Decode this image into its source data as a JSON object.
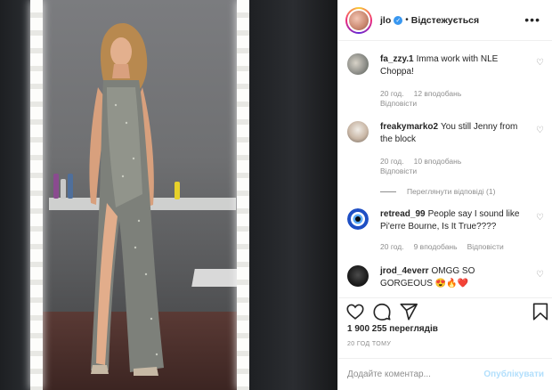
{
  "post": {
    "username": "jlo",
    "dot": "•",
    "follow_state": "Відстежується",
    "more": "•••"
  },
  "comments": [
    {
      "username": "fa_zzy.1",
      "text": "Imma work with NLE Choppa!",
      "time": "20 год.",
      "likes": "12 вподобань",
      "reply": "Відповісти"
    },
    {
      "username": "freakymarko2",
      "text": "You still Jenny from the block",
      "time": "20 год.",
      "likes": "10 вподобань",
      "reply": "Відповісти"
    },
    {
      "username": "retread_99",
      "text": "People say I sound like Pi'erre Bourne, Is It True????",
      "time": "20 год.",
      "likes": "9 вподобань",
      "reply": "Відповісти"
    },
    {
      "username": "jrod_4everr",
      "text": "OMGG SO GORGEOUS 😍🔥❤️"
    }
  ],
  "view_replies": "Переглянути відповіді (1)",
  "actions": {
    "like": "heart-icon",
    "comment": "comment-icon",
    "share": "share-icon",
    "save": "bookmark-icon"
  },
  "views": "1 900 255 переглядів",
  "time_ago": "20 ГОД ТОМУ",
  "add_comment": {
    "placeholder": "Додайте коментар...",
    "publish": "Опублікувати"
  },
  "colors": {
    "accent": "#3897f0",
    "muted": "#8e8e8e",
    "publish_disabled": "#b2dffc"
  }
}
